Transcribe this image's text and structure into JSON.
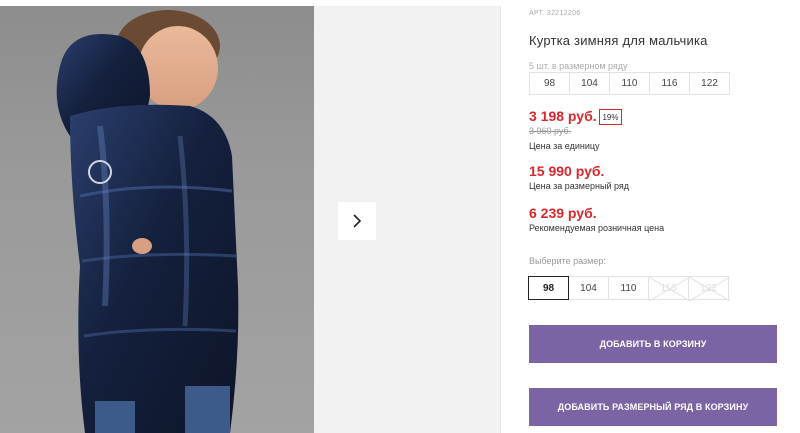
{
  "product": {
    "sku": "АРТ. 32212206",
    "title": "Куртка зимняя для мальчика",
    "pack_note": "5 шт. в размерном ряду",
    "pack_sizes": [
      "98",
      "104",
      "110",
      "116",
      "122"
    ]
  },
  "pricing": {
    "unit_price": "3 198 руб.",
    "discount": "19%",
    "old_price": "3 960 руб.",
    "unit_label": "Цена за единицу",
    "row_price": "15 990 руб.",
    "row_label": "Цена за размерный ряд",
    "retail_price": "6 239 руб.",
    "retail_label": "Рекомендуемая розничная цена"
  },
  "size_picker": {
    "label": "Выберите размер:",
    "options": [
      "98",
      "104",
      "110",
      "116",
      "122"
    ],
    "selected": "98",
    "disabled": [
      "116",
      "122"
    ]
  },
  "actions": {
    "add_to_cart": "ДОБАВИТЬ В КОРЗИНУ",
    "add_row_to_cart": "ДОБАВИТЬ РАЗМЕРНЫЙ РЯД В КОРЗИНУ"
  },
  "gallery": {
    "next_icon": "chevron-right-icon"
  },
  "colors": {
    "price_red": "#d9272e",
    "button_purple": "#7b64a4",
    "jacket_navy": "#1c2a4a"
  }
}
